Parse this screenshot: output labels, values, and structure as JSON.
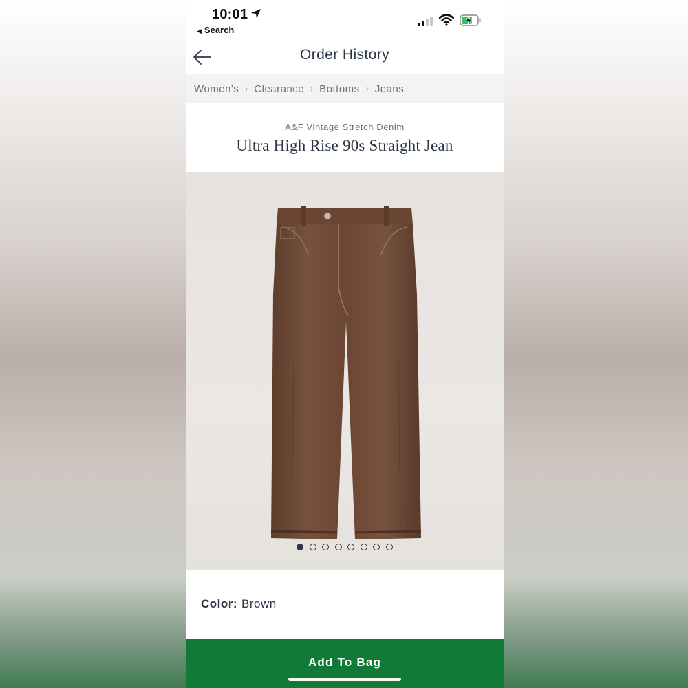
{
  "status_bar": {
    "time": "10:01",
    "back_app_label": "Search"
  },
  "header": {
    "title": "Order History"
  },
  "breadcrumb": [
    "Women's",
    "Clearance",
    "Bottoms",
    "Jeans"
  ],
  "product": {
    "brand_line": "A&F Vintage Stretch Denim",
    "name": "Ultra High Rise 90s Straight Jean",
    "image_count": 8,
    "active_image": 1
  },
  "color": {
    "label": "Color:",
    "value": "Brown"
  },
  "add_to_bag": {
    "label": "Add To Bag"
  },
  "colors": {
    "accent_green": "#117a36",
    "text_dark": "#2b3645",
    "breadcrumb_bg": "#f3f3f3",
    "jean_brown": "#6e4a37"
  }
}
